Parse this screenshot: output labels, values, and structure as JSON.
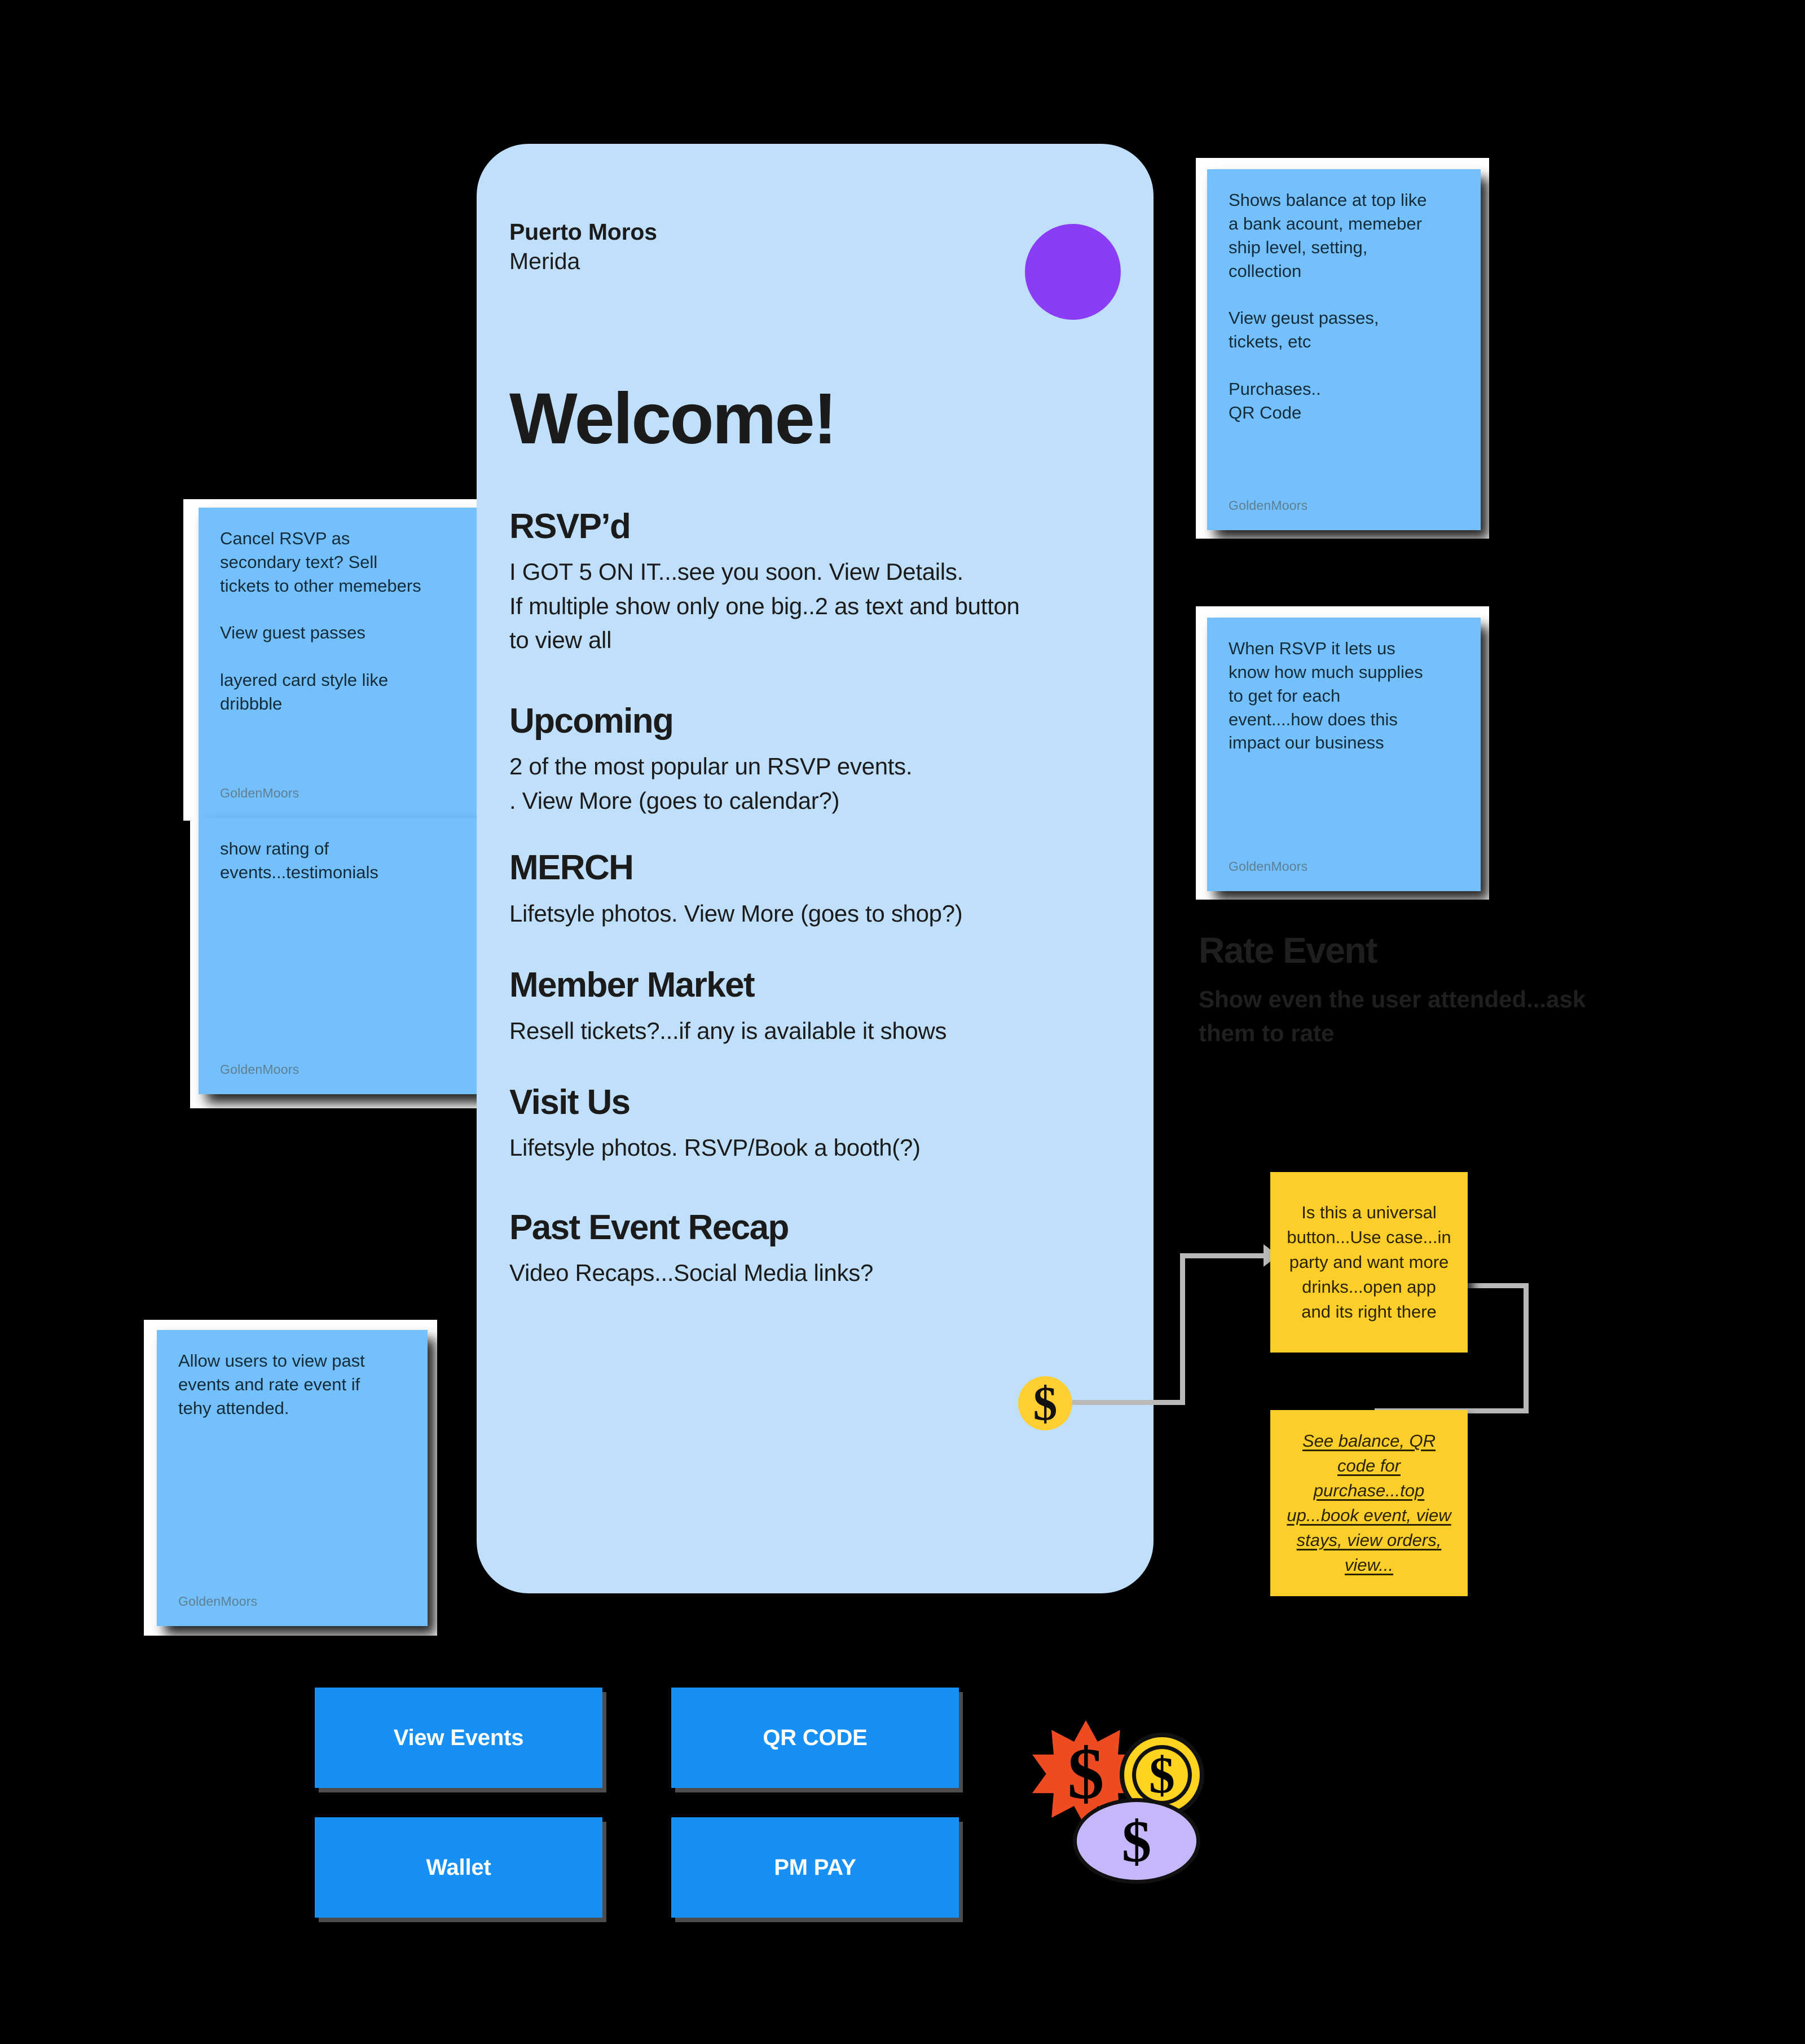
{
  "colors": {
    "background": "#000000",
    "card_blue": "#BFDFFB",
    "note_blue": "#74C0FC",
    "note_yellow": "#FCCE2A",
    "button_blue": "#1790F5",
    "avatar_purple": "#8B3DF5",
    "coin_yellow": "#FFCE31",
    "connector_gray": "#B9B9B9"
  },
  "phone": {
    "brand_line1": "Puerto Moros",
    "brand_line2": "Merida",
    "avatar": "avatar-circle",
    "welcome": "Welcome!",
    "sections": [
      {
        "heading": "RSVP’d",
        "body": "I GOT 5 ON IT...see you soon. View Details.\nIf multiple show only one big..2 as text and button\nto view all"
      },
      {
        "heading": "Upcoming",
        "body": "2 of the most popular un RSVP events.\n. View More (goes to calendar?)"
      },
      {
        "heading": "MERCH",
        "body": "Lifetsyle photos. View More (goes to shop?)"
      },
      {
        "heading": "Member Market",
        "body": "Resell tickets?...if any is available it shows"
      },
      {
        "heading": "Visit Us",
        "body": "Lifetsyle photos. RSVP/Book a booth(?)"
      },
      {
        "heading": "Past Event Recap",
        "body": "Video Recaps...Social Media links?"
      }
    ],
    "dollar_badge": "$"
  },
  "notes": [
    {
      "id": "note-cancel-rsvp",
      "body": "Cancel RSVP as\nsecondary text? Sell\ntickets to other memebers\n\nView guest passes\n\nlayered card style like\ndribbble",
      "author": "GoldenMoors"
    },
    {
      "id": "note-show-rating",
      "body": "show rating of\nevents...testimonials",
      "author": "GoldenMoors"
    },
    {
      "id": "note-allow-users",
      "body": "Allow users to view past\nevents and  rate event if\ntehy attended.",
      "author": "GoldenMoors"
    },
    {
      "id": "note-shows-balance",
      "body": "Shows balance at top like\na bank acount, memeber\nship level, setting,\ncollection\n\nView geust passes,\ntickets, etc\n\nPurchases..\nQR Code",
      "author": "GoldenMoors"
    },
    {
      "id": "note-when-rsvp",
      "body": "When RSVP it lets us\nknow how much supplies\nto get for each\nevent....how does this\nimpact our business",
      "author": "GoldenMoors"
    }
  ],
  "dark_block": {
    "heading": "Rate Event",
    "body": "Show even the user attended...ask\nthem to rate"
  },
  "yellow_notes": [
    {
      "id": "ynote-universal-button",
      "text": "Is this a universal button...Use case...in party and want more drinks...open app and its right there"
    },
    {
      "id": "ynote-see-balance",
      "text": "See balance, QR code for purchase...top up...book event, view stays, view orders, view..."
    }
  ],
  "buttons": [
    {
      "id": "btn-view-events",
      "label": "View Events"
    },
    {
      "id": "btn-qr-code",
      "label": "QR CODE"
    },
    {
      "id": "btn-wallet",
      "label": "Wallet"
    },
    {
      "id": "btn-pm-pay",
      "label": "PM PAY"
    }
  ],
  "money_cluster": {
    "burst_symbol": "$",
    "coin_symbol": "$",
    "oval_symbol": "$"
  }
}
